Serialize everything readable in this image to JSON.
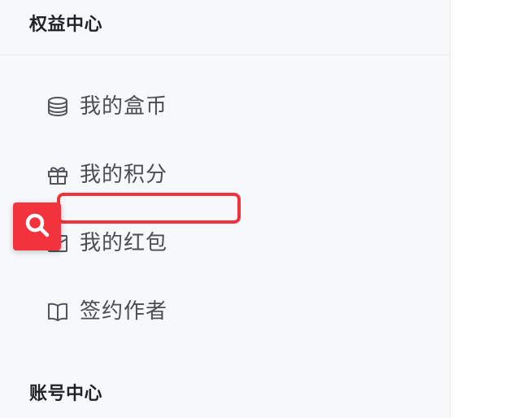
{
  "sections": {
    "rights_center": "权益中心",
    "account_center": "账号中心"
  },
  "menu": {
    "items": [
      {
        "label": "我的盒币",
        "icon": "coin-stack-icon"
      },
      {
        "label": "我的积分",
        "icon": "gift-icon"
      },
      {
        "label": "我的红包",
        "icon": "red-packet-icon"
      },
      {
        "label": "签约作者",
        "icon": "open-book-icon"
      }
    ]
  },
  "search_button": {
    "icon": "search-icon"
  },
  "colors": {
    "accent": "#f2333d",
    "sidebar_bg": "#f7f8fa",
    "text_primary": "#1f2329",
    "text_secondary": "#4a4e55",
    "icon_color": "#50555c"
  }
}
